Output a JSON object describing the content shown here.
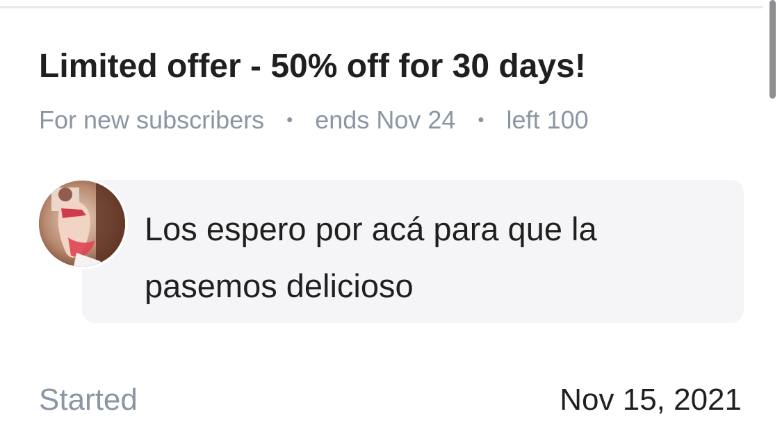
{
  "offer": {
    "title": "Limited offer - 50% off for 30 days!",
    "audience": "For new subscribers",
    "separator": "•",
    "ends": "ends Nov 24",
    "remaining": "left 100"
  },
  "message": {
    "avatar_icon": "user-avatar-photo",
    "text": "Los espero por acá para que la pasemos delicioso"
  },
  "details": {
    "started_label": "Started",
    "started_value": "Nov 15, 2021"
  },
  "colors": {
    "primary_text": "#1f1f1f",
    "secondary_text": "#8a96a3",
    "bubble_background": "#f5f5f7",
    "divider": "#e7e8ea",
    "scrollbar": "#8e8e93"
  }
}
